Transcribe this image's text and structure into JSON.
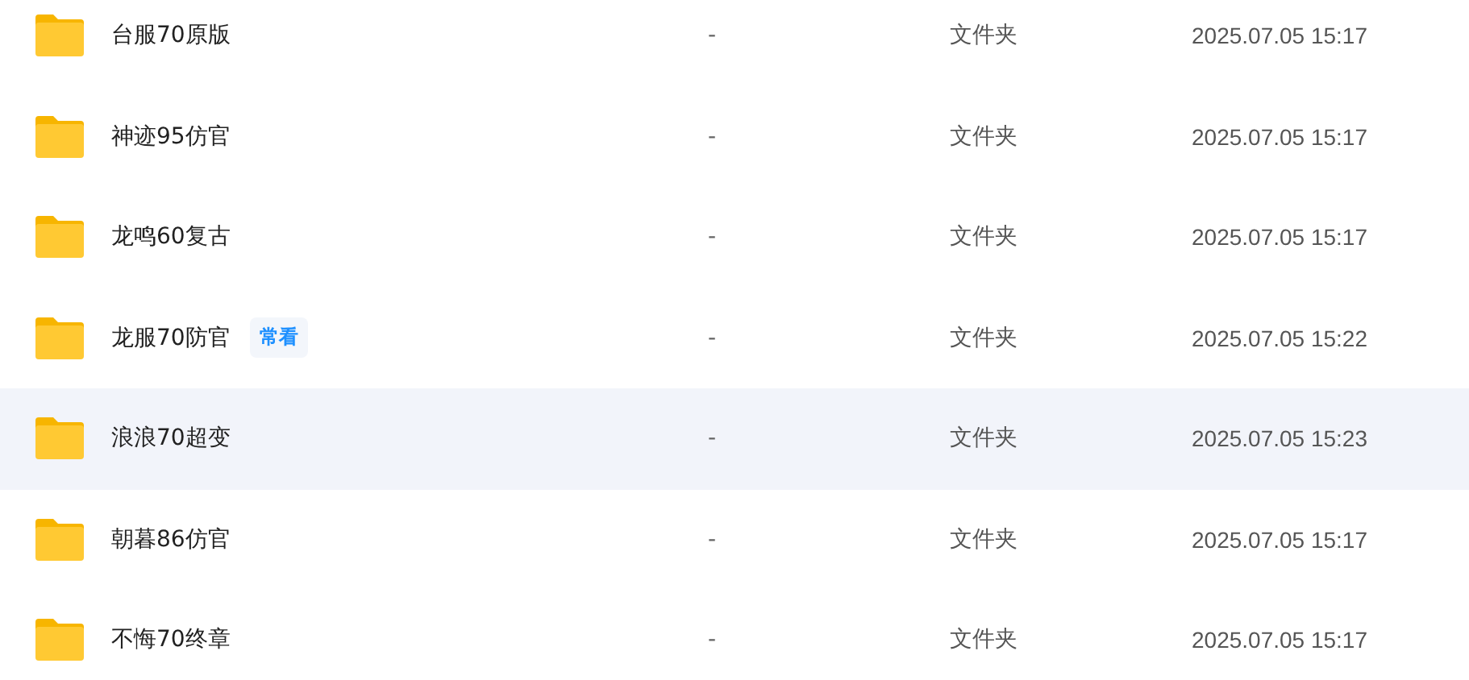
{
  "rows": [
    {
      "name": "台服70原版",
      "size": "-",
      "type": "文件夹",
      "modified": "2025.07.05 15:17",
      "selected": false
    },
    {
      "name": "神迹95仿官",
      "size": "-",
      "type": "文件夹",
      "modified": "2025.07.05 15:17",
      "selected": false
    },
    {
      "name": "龙鸣60复古",
      "size": "-",
      "type": "文件夹",
      "modified": "2025.07.05 15:17",
      "selected": false
    },
    {
      "name": "龙服70防官",
      "tag": "常看",
      "size": "-",
      "type": "文件夹",
      "modified": "2025.07.05 15:22",
      "selected": false
    },
    {
      "name": "浪浪70超变",
      "size": "-",
      "type": "文件夹",
      "modified": "2025.07.05 15:23",
      "selected": true
    },
    {
      "name": "朝暮86仿官",
      "size": "-",
      "type": "文件夹",
      "modified": "2025.07.05 15:17",
      "selected": false
    },
    {
      "name": "不悔70终章",
      "size": "-",
      "type": "文件夹",
      "modified": "2025.07.05 15:17",
      "selected": false
    }
  ]
}
